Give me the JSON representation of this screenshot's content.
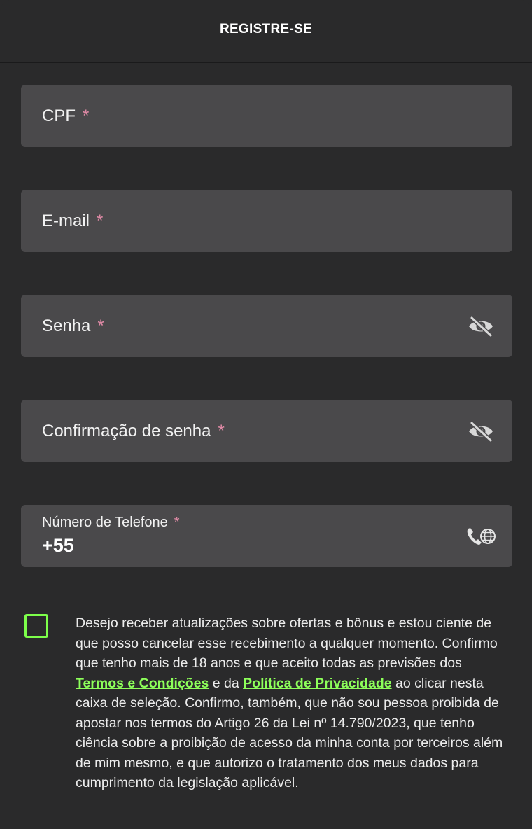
{
  "header": {
    "title": "REGISTRE-SE"
  },
  "fields": {
    "cpf": {
      "label": "CPF",
      "required_mark": "*"
    },
    "email": {
      "label": "E-mail",
      "required_mark": "*"
    },
    "password": {
      "label": "Senha",
      "required_mark": "*",
      "toggle_icon": "eye-off-icon"
    },
    "password_confirm": {
      "label": "Confirmação de senha",
      "required_mark": "*",
      "toggle_icon": "eye-off-icon"
    },
    "phone": {
      "label": "Número de Telefone",
      "required_mark": "*",
      "value": "+55",
      "icon": "phone-globe-icon"
    }
  },
  "consent": {
    "checked": false,
    "text_1": "Desejo receber atualizações sobre ofertas e bônus e estou ciente de que posso cancelar esse recebimento a qualquer momento. Confirmo que tenho mais de 18 anos e que aceito todas as previsões dos ",
    "terms_link": "Termos e Condições",
    "text_2": " e da ",
    "privacy_link": "Política de Privacidade",
    "text_3": " ao clicar nesta caixa de seleção. Confirmo, também, que não sou pessoa proibida de apostar nos termos do Artigo 26 da Lei nº 14.790/2023, que tenho ciência sobre a proibição de acesso da minha conta por terceiros além de mim mesmo, e que autorizo o tratamento dos meus dados para cumprimento da legislação aplicável."
  },
  "colors": {
    "background": "#2a2a2b",
    "field": "#4a494b",
    "required": "#e08aa6",
    "accent": "#7dff4a"
  }
}
